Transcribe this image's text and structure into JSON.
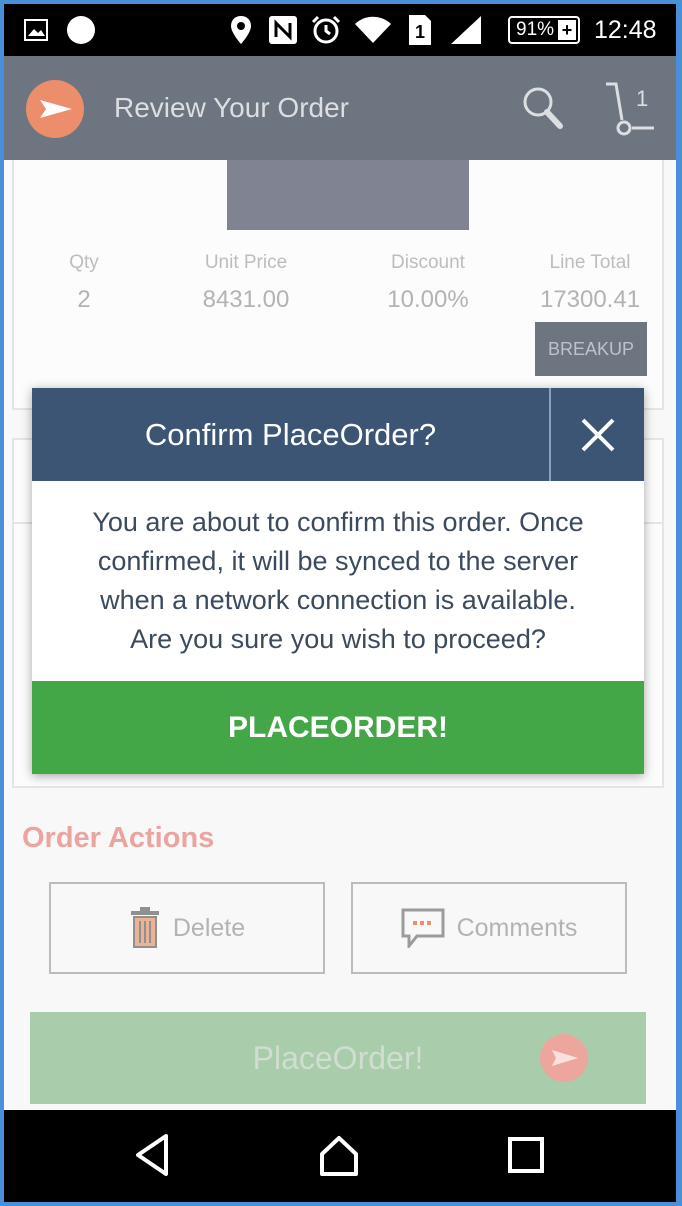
{
  "status_bar": {
    "battery": "91%",
    "sim": "1",
    "time": "12:48",
    "icons": [
      "image-icon",
      "dot-icon",
      "location-icon",
      "nfc-icon",
      "alarm-icon",
      "wifi-icon",
      "sim-icon",
      "signal-icon",
      "battery-icon"
    ]
  },
  "app_bar": {
    "title": "Review Your Order",
    "cart_count": "1",
    "icons": [
      "app-logo-icon",
      "search-icon",
      "cart-icon"
    ]
  },
  "line_item": {
    "columns": [
      {
        "header": "Qty",
        "value": "2"
      },
      {
        "header": "Unit Price",
        "value": "8431.00"
      },
      {
        "header": "Discount",
        "value": "10.00%"
      },
      {
        "header": "Line Total",
        "value": "17300.41"
      }
    ],
    "breakup_label": "BREAKUP"
  },
  "order_actions": {
    "title": "Order Actions",
    "delete_label": "Delete",
    "comments_label": "Comments",
    "place_order_label": "PlaceOrder!"
  },
  "dialog": {
    "title": "Confirm PlaceOrder?",
    "message_lines": [
      "You are about to confirm this order. Once",
      "confirmed, it will be synced to the server",
      "when a network connection is available.",
      "Are you sure you wish to proceed?"
    ],
    "confirm_label": "PLACEORDER!"
  },
  "colors": {
    "app_bar": "#1f2b3d",
    "dialog_header": "#3c5575",
    "confirm_green": "#43a647",
    "accent_orange": "#e2501d",
    "order_actions_title": "#e2746a"
  },
  "nav_bar": {
    "icons": [
      "back-icon",
      "home-icon",
      "recents-icon"
    ]
  }
}
